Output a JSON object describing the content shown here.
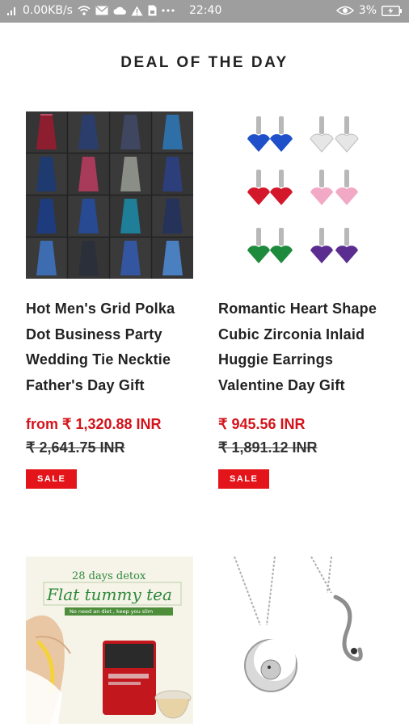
{
  "status_bar": {
    "speed": "0.00KB/s",
    "time": "22:40",
    "battery": "3%",
    "icons": [
      "signal-icon",
      "wifi-icon",
      "mail-icon",
      "cloud-icon",
      "alert-icon",
      "sim-icon",
      "more-icon",
      "eye-icon",
      "battery-icon"
    ]
  },
  "section": {
    "title": "DEAL OF THE DAY"
  },
  "products": [
    {
      "title": "Hot Men's Grid Polka Dot Business Party Wedding Tie Necktie Father's Day Gift",
      "price": "from ₹ 1,320.88 INR",
      "compare_price": "₹ 2,641.75 INR",
      "badge": "SALE"
    },
    {
      "title": "Romantic Heart Shape Cubic Zirconia Inlaid Huggie Earrings Valentine Day Gift",
      "price": "₹ 945.56 INR",
      "compare_price": "₹ 1,891.12 INR",
      "badge": "SALE"
    },
    {
      "image_text": {
        "headline": "28 days detox",
        "title": "Flat tummy tea",
        "banner": "No need an diet , keep you slim"
      }
    },
    {}
  ],
  "colors": {
    "accent": "#e3151b",
    "price": "#d4131a",
    "status_bar": "#9e9e9e"
  }
}
